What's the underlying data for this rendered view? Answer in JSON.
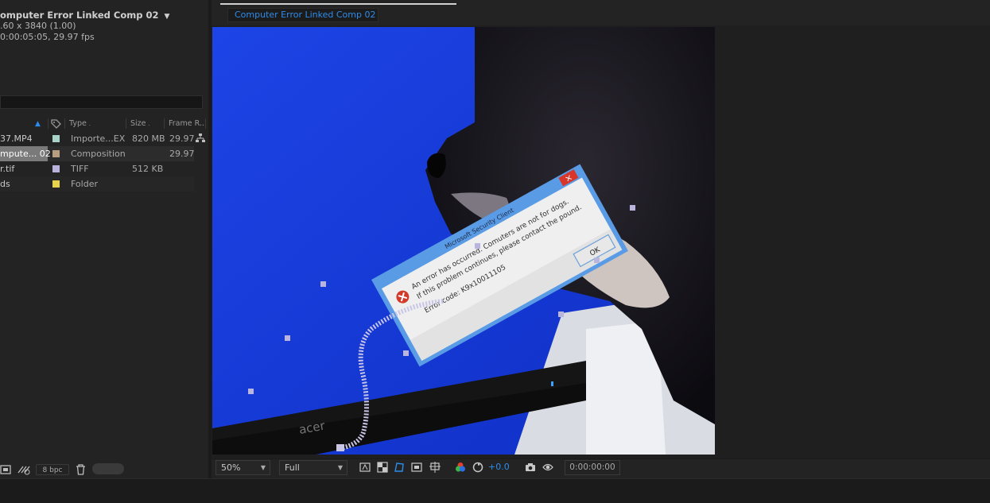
{
  "project": {
    "comp_title": "omputer Error Linked Comp 02",
    "comp_dims": ".60 x 3840 (1.00)",
    "comp_duration": "0:00:05:05, 29.97 fps",
    "search_value": "",
    "columns": {
      "type": "Type",
      "size": "Size",
      "frame_rate": "Frame R..."
    },
    "items": [
      {
        "name": "37.MP4",
        "type": "Importe...EX",
        "size": "820 MB",
        "frame_rate": "29.97",
        "label_color": "#a9d3c8"
      },
      {
        "name": "mpute... 02",
        "type": "Composition",
        "size": "",
        "frame_rate": "29.97",
        "label_color": "#b79e80"
      },
      {
        "name": "r.tif",
        "type": "TIFF",
        "size": "512 KB",
        "frame_rate": "",
        "label_color": "#b9b2dc"
      },
      {
        "name": "ds",
        "type": "Folder",
        "size": "",
        "frame_rate": "",
        "label_color": "#e8d34c"
      }
    ],
    "bpc_label": "8 bpc"
  },
  "viewer": {
    "tab_label": "Computer Error Linked Comp 02",
    "zoom": "50%",
    "resolution": "Full",
    "exposure": "+0.0",
    "timecode": "0:00:00:00"
  },
  "dialog": {
    "title": "Microsoft Security Client",
    "line1": "An error has occurred. Comuters are not for dogs.",
    "line2": "If this problem continues, please contact the pound.",
    "line3": "Error code: K9x10011105",
    "ok_label": "OK",
    "close_label": "×"
  },
  "monitor_brand": "acer",
  "colors": {
    "accent_blue": "#2d8ceb",
    "screen_blue": "#1c3fe0",
    "panel_bg": "#232323"
  }
}
